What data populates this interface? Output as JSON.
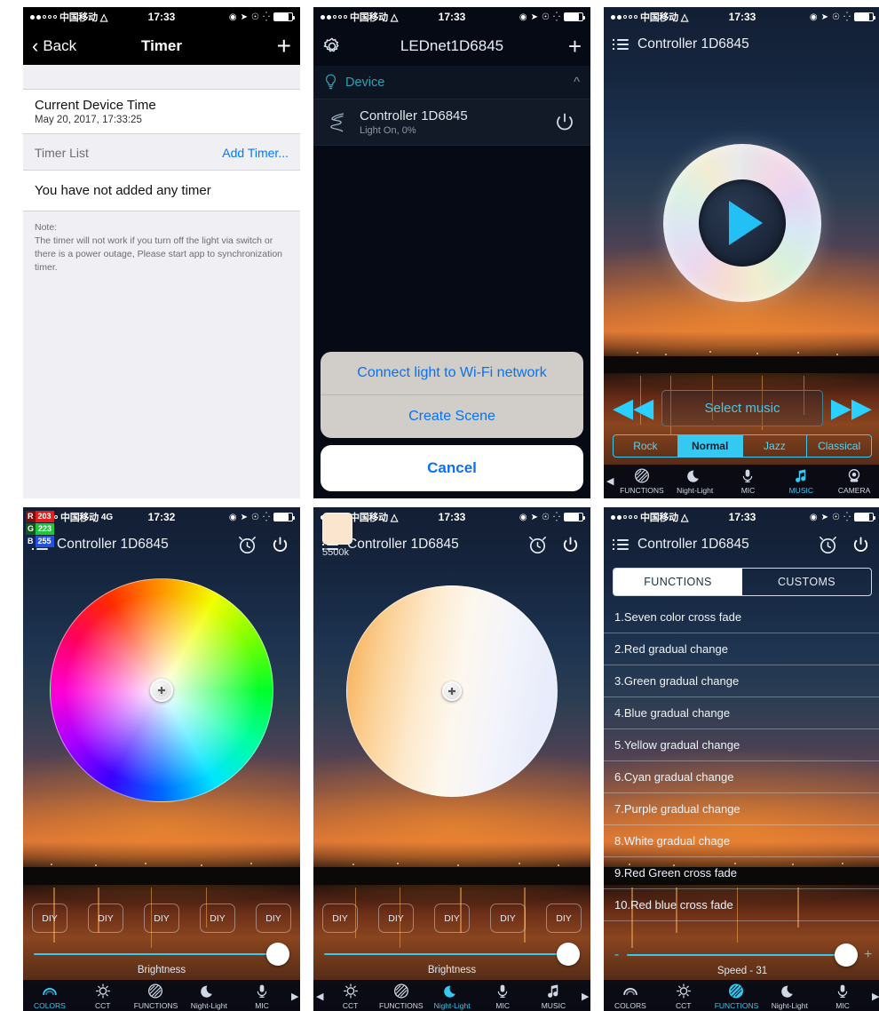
{
  "status_bars": {
    "carrier": "中国移动",
    "wifi_glyph": "▾",
    "time_1733": "17:33",
    "time_1732": "17:32",
    "net_4g": "4G"
  },
  "panel1_timer": {
    "nav": {
      "back": "Back",
      "title": "Timer",
      "add": "+"
    },
    "current_time_label": "Current Device Time",
    "current_time_value": "May 20, 2017, 17:33:25",
    "section_label": "Timer List",
    "section_action": "Add Timer...",
    "empty_text": "You have not added any timer",
    "note_title": "Note:",
    "note_body": "The timer will not work if you turn off the light via switch or there is a power outage, Please start app to synchronization timer."
  },
  "panel2_device": {
    "nav": {
      "title": "LEDnet1D6845",
      "add": "+",
      "settings_icon": "gear-icon"
    },
    "group_label": "Device",
    "device_name": "Controller 1D6845",
    "device_state": "Light On, 0%",
    "sheet": {
      "connect": "Connect light to Wi-Fi network",
      "create_scene": "Create Scene",
      "cancel": "Cancel"
    }
  },
  "panel3_music": {
    "title": "Controller 1D6845",
    "select_music": "Select music",
    "prev_icon": "rewind-icon",
    "next_icon": "fast-forward-icon",
    "play_icon": "play-icon",
    "modes": [
      "Rock",
      "Normal",
      "Jazz",
      "Classical"
    ],
    "active_mode": "Normal",
    "tabs": [
      {
        "label": "FUNCTIONS",
        "icon": "functions-icon",
        "active": false
      },
      {
        "label": "Night-Light",
        "icon": "moon-icon",
        "active": false
      },
      {
        "label": "MIC",
        "icon": "mic-icon",
        "active": false
      },
      {
        "label": "MUSIC",
        "icon": "music-note-icon",
        "active": true
      },
      {
        "label": "CAMERA",
        "icon": "camera-icon",
        "active": false
      }
    ]
  },
  "panel4_colors": {
    "title": "Controller 1D6845",
    "rgb": {
      "r_label": "R",
      "r_value": "203",
      "g_label": "G",
      "g_value": "223",
      "b_label": "B",
      "b_value": "255"
    },
    "diy_labels": [
      "DIY",
      "DIY",
      "DIY",
      "DIY",
      "DIY"
    ],
    "slider_label": "Brightness",
    "tabs": [
      {
        "label": "COLORS",
        "icon": "rainbow-icon",
        "active": true
      },
      {
        "label": "CCT",
        "icon": "sun-icon",
        "active": false
      },
      {
        "label": "FUNCTIONS",
        "icon": "functions-icon",
        "active": false
      },
      {
        "label": "Night-Light",
        "icon": "moon-icon",
        "active": false
      },
      {
        "label": "MIC",
        "icon": "mic-icon",
        "active": false
      }
    ]
  },
  "panel5_cct": {
    "title": "Controller 1D6845",
    "kelvin": "5500k",
    "diy_labels": [
      "DIY",
      "DIY",
      "DIY",
      "DIY",
      "DIY"
    ],
    "slider_label": "Brightness",
    "tabs": [
      {
        "label": "CCT",
        "icon": "sun-icon",
        "active": false
      },
      {
        "label": "FUNCTIONS",
        "icon": "functions-icon",
        "active": false
      },
      {
        "label": "Night-Light",
        "icon": "moon-icon",
        "active": true
      },
      {
        "label": "MIC",
        "icon": "mic-icon",
        "active": false
      },
      {
        "label": "MUSIC",
        "icon": "music-note-icon",
        "active": false
      }
    ]
  },
  "panel6_functions": {
    "title": "Controller 1D6845",
    "segments": [
      "FUNCTIONS",
      "CUSTOMS"
    ],
    "active_segment": "FUNCTIONS",
    "items": [
      "1.Seven color cross fade",
      "2.Red gradual change",
      "3.Green gradual change",
      "4.Blue gradual change",
      "5.Yellow gradual change",
      "6.Cyan gradual change",
      "7.Purple gradual change",
      "8.White gradual chage",
      "9.Red Green cross fade",
      "10.Red blue cross fade"
    ],
    "speed_label": "Speed - 31",
    "minus": "-",
    "plus": "+",
    "tabs": [
      {
        "label": "COLORS",
        "icon": "rainbow-icon",
        "active": false
      },
      {
        "label": "CCT",
        "icon": "sun-icon",
        "active": false
      },
      {
        "label": "FUNCTIONS",
        "icon": "functions-icon",
        "active": true
      },
      {
        "label": "Night-Light",
        "icon": "moon-icon",
        "active": false
      },
      {
        "label": "MIC",
        "icon": "mic-icon",
        "active": false
      }
    ]
  },
  "colors": {
    "accent_cyan": "#35c9f2",
    "ios_blue": "#007aff",
    "teal": "#2f9fb3"
  }
}
